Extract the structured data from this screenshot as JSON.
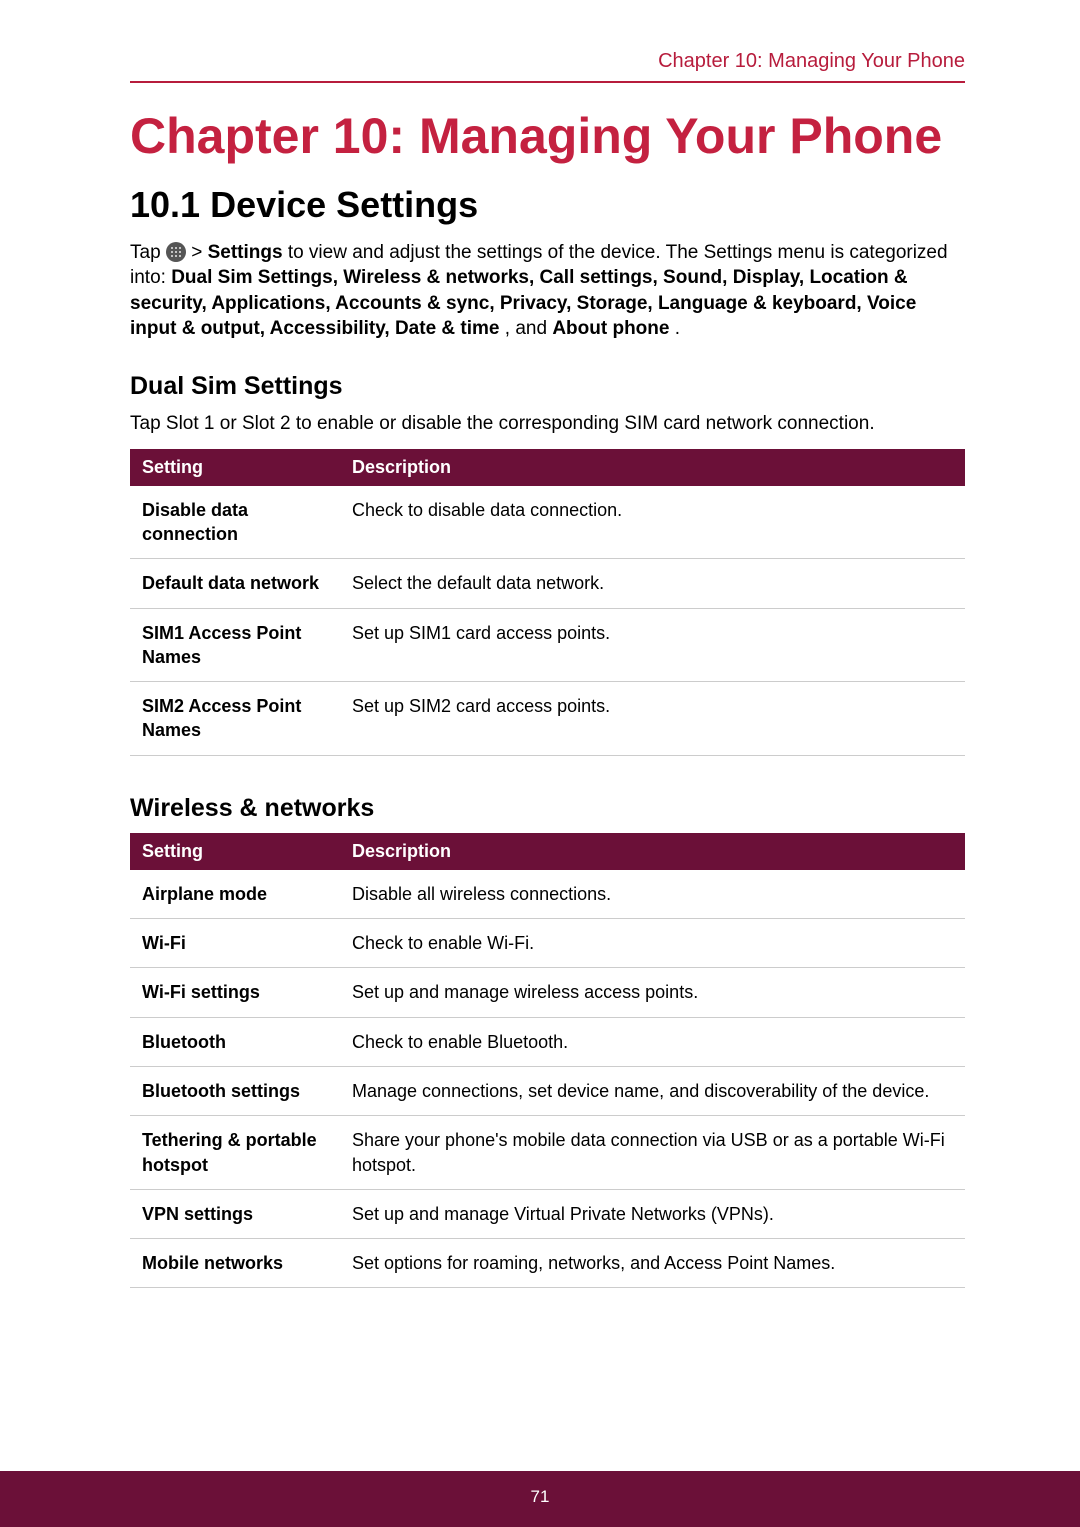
{
  "header": {
    "running_title": "Chapter 10: Managing Your Phone"
  },
  "chapter": {
    "title": "Chapter 10: Managing Your Phone"
  },
  "section": {
    "title": "10.1 Device Settings",
    "intro_pre": "Tap ",
    "intro_settings_label": "Settings",
    "intro_post": " to view and adjust the settings of the device. The Settings menu is categorized into: ",
    "categories": "Dual Sim Settings, Wireless & networks, Call settings, Sound, Display, Location & security, Applications, Accounts & sync, Privacy, Storage, Language & keyboard, Voice input & output, Accessibility, Date & time",
    "and": ", and ",
    "about_phone": "About phone",
    "period": "."
  },
  "dual_sim": {
    "heading": "Dual Sim Settings",
    "desc": "Tap Slot 1 or Slot 2 to enable or disable the corresponding SIM card network connection.",
    "table": {
      "col1": "Setting",
      "col2": "Description",
      "rows": [
        {
          "setting": "Disable data connection",
          "desc": "Check to disable data connection."
        },
        {
          "setting": "Default data network",
          "desc": "Select the default data network."
        },
        {
          "setting": "SIM1 Access Point Names",
          "desc": "Set up SIM1 card access points."
        },
        {
          "setting": "SIM2 Access Point Names",
          "desc": "Set up SIM2 card access points."
        }
      ]
    }
  },
  "wireless": {
    "heading": "Wireless & networks",
    "table": {
      "col1": "Setting",
      "col2": "Description",
      "rows": [
        {
          "setting": "Airplane mode",
          "desc": "Disable all wireless connections."
        },
        {
          "setting": "Wi-Fi",
          "desc": "Check to enable Wi-Fi."
        },
        {
          "setting": "Wi-Fi settings",
          "desc": "Set up and manage wireless access points."
        },
        {
          "setting": "Bluetooth",
          "desc": "Check to enable Bluetooth."
        },
        {
          "setting": "Bluetooth settings",
          "desc": "Manage connections, set device name, and discoverability of the device."
        },
        {
          "setting": "Tethering & portable hotspot",
          "desc": "Share your phone's mobile data connection via USB or as a portable Wi-Fi hotspot."
        },
        {
          "setting": "VPN settings",
          "desc": "Set up and manage Virtual Private Networks (VPNs)."
        },
        {
          "setting": "Mobile networks",
          "desc": "Set options for roaming, networks, and Access Point Names."
        }
      ]
    }
  },
  "footer": {
    "page_number": "71"
  }
}
